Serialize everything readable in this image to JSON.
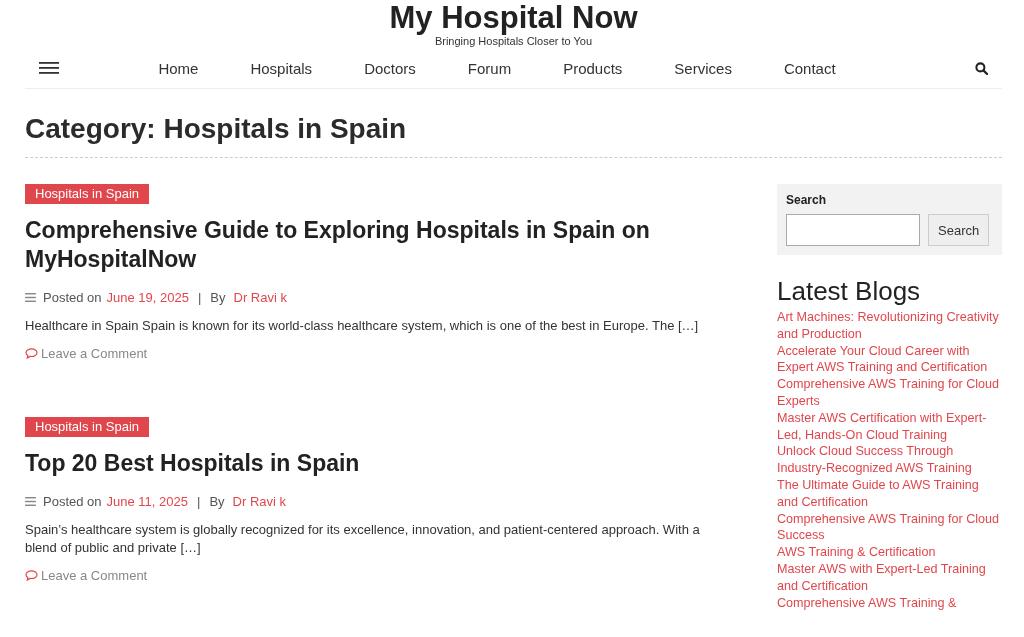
{
  "site": {
    "title": "My Hospital Now",
    "tagline": "Bringing Hospitals Closer to You"
  },
  "nav": {
    "items": [
      "Home",
      "Hospitals",
      "Doctors",
      "Forum",
      "Products",
      "Services",
      "Contact"
    ]
  },
  "page_title": "Category: Hospitals in Spain",
  "posts": [
    {
      "category": "Hospitals in Spain",
      "title": "Comprehensive Guide to Exploring Hospitals in Spain on MyHospitalNow",
      "posted_label": "Posted on",
      "date": "June 19, 2025",
      "separator": "|",
      "by_label": "By",
      "author": "Dr Ravi k",
      "excerpt": "Healthcare in Spain Spain is known for its world-class healthcare system, which is one of the best in Europe. The […]",
      "comment_link": "Leave a Comment"
    },
    {
      "category": "Hospitals in Spain",
      "title": "Top 20 Best Hospitals in Spain",
      "posted_label": "Posted on",
      "date": "June 11, 2025",
      "separator": "|",
      "by_label": "By",
      "author": "Dr Ravi k",
      "excerpt": "Spain’s healthcare system is globally recognized for its excellence, innovation, and patient-centered approach. With a blend of public and private […]",
      "comment_link": "Leave a Comment"
    }
  ],
  "sidebar": {
    "search": {
      "label": "Search",
      "button": "Search"
    },
    "latest_blogs": {
      "title": "Latest Blogs",
      "items": [
        "Art Machines: Revolutionizing Creativity and Production",
        "Accelerate Your Cloud Career with Expert AWS Training and Certification",
        "Comprehensive AWS Training for Cloud Experts",
        "Master AWS Certification with Expert-Led, Hands-On Cloud Training",
        "Unlock Cloud Success Through Industry-Recognized AWS Training",
        "The Ultimate Guide to AWS Training and Certification",
        "Comprehensive AWS Training for Cloud Success",
        "AWS Training & Certification",
        "Master AWS with Expert-Led Training and Certification",
        "Comprehensive AWS Training &"
      ]
    }
  }
}
